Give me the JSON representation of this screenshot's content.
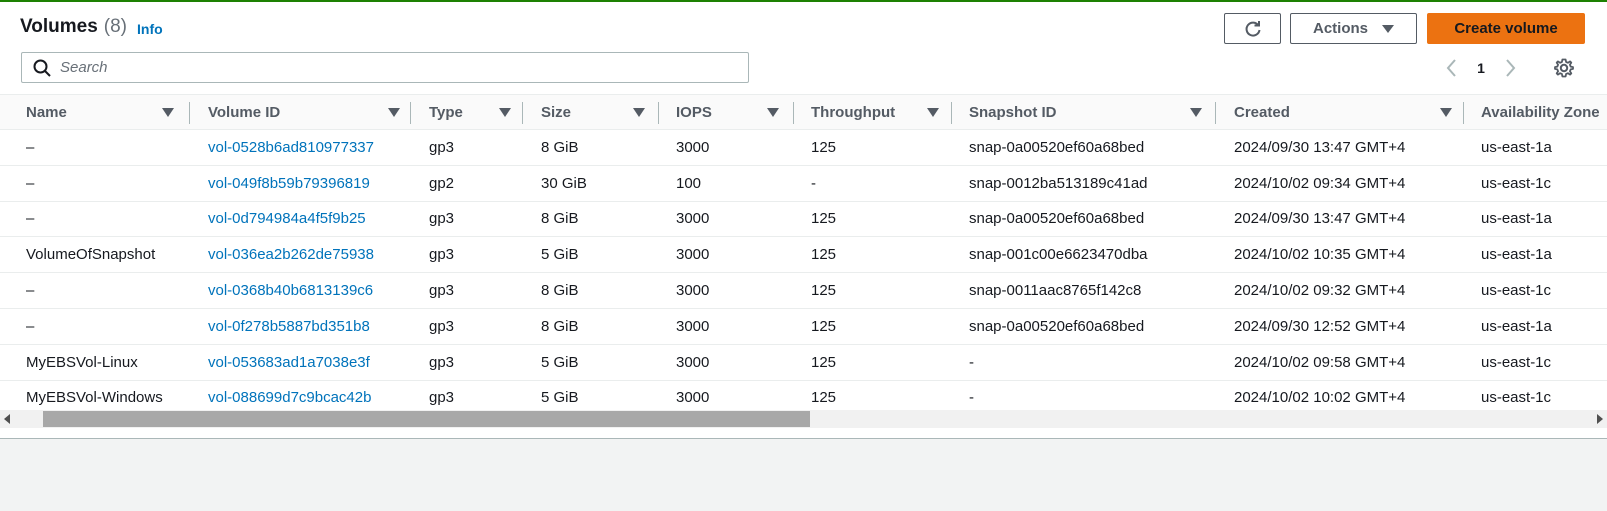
{
  "header": {
    "title": "Volumes",
    "count": "(8)",
    "info_label": "Info"
  },
  "toolbar": {
    "refresh_icon": "refresh-icon",
    "actions_label": "Actions",
    "create_label": "Create volume"
  },
  "search": {
    "placeholder": "Search",
    "value": ""
  },
  "pagination": {
    "current_page": "1"
  },
  "colors": {
    "primary_button": "#ec7211",
    "link": "#0073bb",
    "success_bar": "#1d8102"
  },
  "table": {
    "columns": [
      "Name",
      "Volume ID",
      "Type",
      "Size",
      "IOPS",
      "Throughput",
      "Snapshot ID",
      "Created",
      "Availability Zone"
    ],
    "rows": [
      {
        "name": "–",
        "volume_id": "vol-0528b6ad810977337",
        "type": "gp3",
        "size": "8 GiB",
        "iops": "3000",
        "throughput": "125",
        "snapshot_id": "snap-0a00520ef60a68bed",
        "created": "2024/09/30 13:47 GMT+4",
        "az": "us-east-1a"
      },
      {
        "name": "–",
        "volume_id": "vol-049f8b59b79396819",
        "type": "gp2",
        "size": "30 GiB",
        "iops": "100",
        "throughput": "-",
        "snapshot_id": "snap-0012ba513189c41ad",
        "created": "2024/10/02 09:34 GMT+4",
        "az": "us-east-1c"
      },
      {
        "name": "–",
        "volume_id": "vol-0d794984a4f5f9b25",
        "type": "gp3",
        "size": "8 GiB",
        "iops": "3000",
        "throughput": "125",
        "snapshot_id": "snap-0a00520ef60a68bed",
        "created": "2024/09/30 13:47 GMT+4",
        "az": "us-east-1a"
      },
      {
        "name": "VolumeOfSnapshot",
        "volume_id": "vol-036ea2b262de75938",
        "type": "gp3",
        "size": "5 GiB",
        "iops": "3000",
        "throughput": "125",
        "snapshot_id": "snap-001c00e6623470dba",
        "created": "2024/10/02 10:35 GMT+4",
        "az": "us-east-1a"
      },
      {
        "name": "–",
        "volume_id": "vol-0368b40b6813139c6",
        "type": "gp3",
        "size": "8 GiB",
        "iops": "3000",
        "throughput": "125",
        "snapshot_id": "snap-0011aac8765f142c8",
        "created": "2024/10/02 09:32 GMT+4",
        "az": "us-east-1c"
      },
      {
        "name": "–",
        "volume_id": "vol-0f278b5887bd351b8",
        "type": "gp3",
        "size": "8 GiB",
        "iops": "3000",
        "throughput": "125",
        "snapshot_id": "snap-0a00520ef60a68bed",
        "created": "2024/09/30 12:52 GMT+4",
        "az": "us-east-1a"
      },
      {
        "name": "MyEBSVol-Linux",
        "volume_id": "vol-053683ad1a7038e3f",
        "type": "gp3",
        "size": "5 GiB",
        "iops": "3000",
        "throughput": "125",
        "snapshot_id": "-",
        "created": "2024/10/02 09:58 GMT+4",
        "az": "us-east-1c"
      },
      {
        "name": "MyEBSVol-Windows",
        "volume_id": "vol-088699d7c9bcac42b",
        "type": "gp3",
        "size": "5 GiB",
        "iops": "3000",
        "throughput": "125",
        "snapshot_id": "-",
        "created": "2024/10/02 10:02 GMT+4",
        "az": "us-east-1c"
      }
    ]
  }
}
